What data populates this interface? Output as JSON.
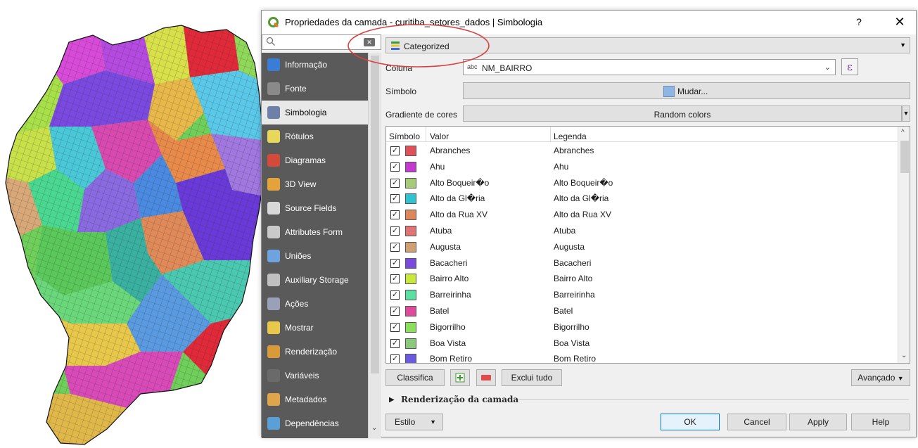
{
  "window": {
    "title": "Propriedades da camada - curitiba_setores_dados | Simbologia",
    "help": "?",
    "close": "✕"
  },
  "search": {
    "placeholder": "",
    "clear": "✕"
  },
  "sidebar": {
    "items": [
      {
        "label": "Informação",
        "icon": "info-icon",
        "color": "#3a7dd6"
      },
      {
        "label": "Fonte",
        "icon": "source-icon",
        "color": "#8a8a8a"
      },
      {
        "label": "Simbologia",
        "icon": "paint-icon",
        "color": "#6e7fa8"
      },
      {
        "label": "Rótulos",
        "icon": "labels-icon",
        "color": "#e8d85a"
      },
      {
        "label": "Diagramas",
        "icon": "diagram-icon",
        "color": "#d44a3a"
      },
      {
        "label": "3D View",
        "icon": "cube-icon",
        "color": "#e3a33a"
      },
      {
        "label": "Source Fields",
        "icon": "fields-icon",
        "color": "#d8d8d8"
      },
      {
        "label": "Attributes Form",
        "icon": "form-icon",
        "color": "#c9c9c9"
      },
      {
        "label": "Uniões",
        "icon": "join-icon",
        "color": "#6ea3e0"
      },
      {
        "label": "Auxiliary Storage",
        "icon": "storage-icon",
        "color": "#c0c0c0"
      },
      {
        "label": "Ações",
        "icon": "gear-icon",
        "color": "#9aa0b8"
      },
      {
        "label": "Mostrar",
        "icon": "chat-icon",
        "color": "#e8c84a"
      },
      {
        "label": "Renderização",
        "icon": "brush-icon",
        "color": "#d99a3a"
      },
      {
        "label": "Variáveis",
        "icon": "variable-icon",
        "color": "#6a6a6a"
      },
      {
        "label": "Metadados",
        "icon": "metadata-icon",
        "color": "#e0a44a"
      },
      {
        "label": "Dependências",
        "icon": "dependency-icon",
        "color": "#5aa0d8"
      }
    ],
    "active_index": 2
  },
  "renderer": {
    "label": "Categorized"
  },
  "coluna": {
    "label": "Coluna",
    "type_badge": "abc",
    "value": "NM_BAIRRO",
    "expr_symbol": "ε"
  },
  "simbolo": {
    "label": "Símbolo",
    "button": "Mudar..."
  },
  "gradiente": {
    "label": "Gradiente de cores",
    "value": "Random colors"
  },
  "table": {
    "headers": {
      "symbol": "Símbolo",
      "value": "Valor",
      "legend": "Legenda"
    },
    "rows": [
      {
        "value": "Abranches",
        "legend": "Abranches",
        "color": "#e0515a"
      },
      {
        "value": "Ahu",
        "legend": "Ahu",
        "color": "#c43ad0"
      },
      {
        "value": "Alto Boqueir�o",
        "legend": "Alto Boqueir�o",
        "color": "#a6cc7a"
      },
      {
        "value": "Alto da Gl�ria",
        "legend": "Alto da Gl�ria",
        "color": "#2ec4d0"
      },
      {
        "value": "Alto da Rua XV",
        "legend": "Alto da Rua XV",
        "color": "#e0865a"
      },
      {
        "value": "Atuba",
        "legend": "Atuba",
        "color": "#e07474"
      },
      {
        "value": "Augusta",
        "legend": "Augusta",
        "color": "#d0a070"
      },
      {
        "value": "Bacacheri",
        "legend": "Bacacheri",
        "color": "#7a4ae0"
      },
      {
        "value": "Bairro Alto",
        "legend": "Bairro Alto",
        "color": "#c8e83a"
      },
      {
        "value": "Barreirinha",
        "legend": "Barreirinha",
        "color": "#5ae0a0"
      },
      {
        "value": "Batel",
        "legend": "Batel",
        "color": "#e04a9a"
      },
      {
        "value": "Bigorrilho",
        "legend": "Bigorrilho",
        "color": "#8ae05a"
      },
      {
        "value": "Boa Vista",
        "legend": "Boa Vista",
        "color": "#8ac87a"
      },
      {
        "value": "Bom Retiro",
        "legend": "Bom Retiro",
        "color": "#6a5ae0"
      }
    ]
  },
  "buttons": {
    "classifica": "Classifica",
    "exclui": "Exclui tudo",
    "avancado": "Avançado",
    "estilo": "Estilo",
    "ok": "OK",
    "cancel": "Cancel",
    "apply": "Apply",
    "help": "Help"
  },
  "section": {
    "render_label": "Renderização da camada"
  },
  "annotation_color": "#d94040"
}
